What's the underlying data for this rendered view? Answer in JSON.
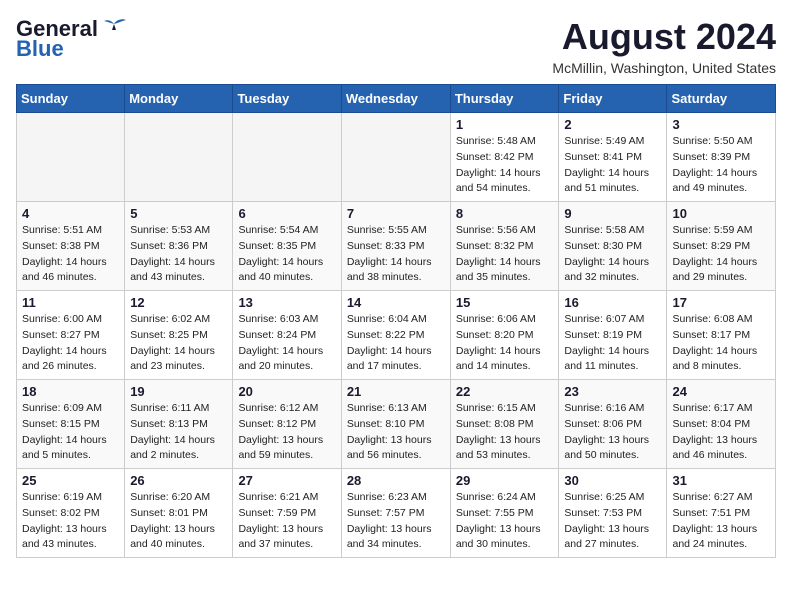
{
  "header": {
    "logo_line1": "General",
    "logo_line2": "Blue",
    "month_year": "August 2024",
    "location": "McMillin, Washington, United States"
  },
  "weekdays": [
    "Sunday",
    "Monday",
    "Tuesday",
    "Wednesday",
    "Thursday",
    "Friday",
    "Saturday"
  ],
  "weeks": [
    [
      {
        "day": "",
        "info": ""
      },
      {
        "day": "",
        "info": ""
      },
      {
        "day": "",
        "info": ""
      },
      {
        "day": "",
        "info": ""
      },
      {
        "day": "1",
        "info": "Sunrise: 5:48 AM\nSunset: 8:42 PM\nDaylight: 14 hours\nand 54 minutes."
      },
      {
        "day": "2",
        "info": "Sunrise: 5:49 AM\nSunset: 8:41 PM\nDaylight: 14 hours\nand 51 minutes."
      },
      {
        "day": "3",
        "info": "Sunrise: 5:50 AM\nSunset: 8:39 PM\nDaylight: 14 hours\nand 49 minutes."
      }
    ],
    [
      {
        "day": "4",
        "info": "Sunrise: 5:51 AM\nSunset: 8:38 PM\nDaylight: 14 hours\nand 46 minutes."
      },
      {
        "day": "5",
        "info": "Sunrise: 5:53 AM\nSunset: 8:36 PM\nDaylight: 14 hours\nand 43 minutes."
      },
      {
        "day": "6",
        "info": "Sunrise: 5:54 AM\nSunset: 8:35 PM\nDaylight: 14 hours\nand 40 minutes."
      },
      {
        "day": "7",
        "info": "Sunrise: 5:55 AM\nSunset: 8:33 PM\nDaylight: 14 hours\nand 38 minutes."
      },
      {
        "day": "8",
        "info": "Sunrise: 5:56 AM\nSunset: 8:32 PM\nDaylight: 14 hours\nand 35 minutes."
      },
      {
        "day": "9",
        "info": "Sunrise: 5:58 AM\nSunset: 8:30 PM\nDaylight: 14 hours\nand 32 minutes."
      },
      {
        "day": "10",
        "info": "Sunrise: 5:59 AM\nSunset: 8:29 PM\nDaylight: 14 hours\nand 29 minutes."
      }
    ],
    [
      {
        "day": "11",
        "info": "Sunrise: 6:00 AM\nSunset: 8:27 PM\nDaylight: 14 hours\nand 26 minutes."
      },
      {
        "day": "12",
        "info": "Sunrise: 6:02 AM\nSunset: 8:25 PM\nDaylight: 14 hours\nand 23 minutes."
      },
      {
        "day": "13",
        "info": "Sunrise: 6:03 AM\nSunset: 8:24 PM\nDaylight: 14 hours\nand 20 minutes."
      },
      {
        "day": "14",
        "info": "Sunrise: 6:04 AM\nSunset: 8:22 PM\nDaylight: 14 hours\nand 17 minutes."
      },
      {
        "day": "15",
        "info": "Sunrise: 6:06 AM\nSunset: 8:20 PM\nDaylight: 14 hours\nand 14 minutes."
      },
      {
        "day": "16",
        "info": "Sunrise: 6:07 AM\nSunset: 8:19 PM\nDaylight: 14 hours\nand 11 minutes."
      },
      {
        "day": "17",
        "info": "Sunrise: 6:08 AM\nSunset: 8:17 PM\nDaylight: 14 hours\nand 8 minutes."
      }
    ],
    [
      {
        "day": "18",
        "info": "Sunrise: 6:09 AM\nSunset: 8:15 PM\nDaylight: 14 hours\nand 5 minutes."
      },
      {
        "day": "19",
        "info": "Sunrise: 6:11 AM\nSunset: 8:13 PM\nDaylight: 14 hours\nand 2 minutes."
      },
      {
        "day": "20",
        "info": "Sunrise: 6:12 AM\nSunset: 8:12 PM\nDaylight: 13 hours\nand 59 minutes."
      },
      {
        "day": "21",
        "info": "Sunrise: 6:13 AM\nSunset: 8:10 PM\nDaylight: 13 hours\nand 56 minutes."
      },
      {
        "day": "22",
        "info": "Sunrise: 6:15 AM\nSunset: 8:08 PM\nDaylight: 13 hours\nand 53 minutes."
      },
      {
        "day": "23",
        "info": "Sunrise: 6:16 AM\nSunset: 8:06 PM\nDaylight: 13 hours\nand 50 minutes."
      },
      {
        "day": "24",
        "info": "Sunrise: 6:17 AM\nSunset: 8:04 PM\nDaylight: 13 hours\nand 46 minutes."
      }
    ],
    [
      {
        "day": "25",
        "info": "Sunrise: 6:19 AM\nSunset: 8:02 PM\nDaylight: 13 hours\nand 43 minutes."
      },
      {
        "day": "26",
        "info": "Sunrise: 6:20 AM\nSunset: 8:01 PM\nDaylight: 13 hours\nand 40 minutes."
      },
      {
        "day": "27",
        "info": "Sunrise: 6:21 AM\nSunset: 7:59 PM\nDaylight: 13 hours\nand 37 minutes."
      },
      {
        "day": "28",
        "info": "Sunrise: 6:23 AM\nSunset: 7:57 PM\nDaylight: 13 hours\nand 34 minutes."
      },
      {
        "day": "29",
        "info": "Sunrise: 6:24 AM\nSunset: 7:55 PM\nDaylight: 13 hours\nand 30 minutes."
      },
      {
        "day": "30",
        "info": "Sunrise: 6:25 AM\nSunset: 7:53 PM\nDaylight: 13 hours\nand 27 minutes."
      },
      {
        "day": "31",
        "info": "Sunrise: 6:27 AM\nSunset: 7:51 PM\nDaylight: 13 hours\nand 24 minutes."
      }
    ]
  ]
}
